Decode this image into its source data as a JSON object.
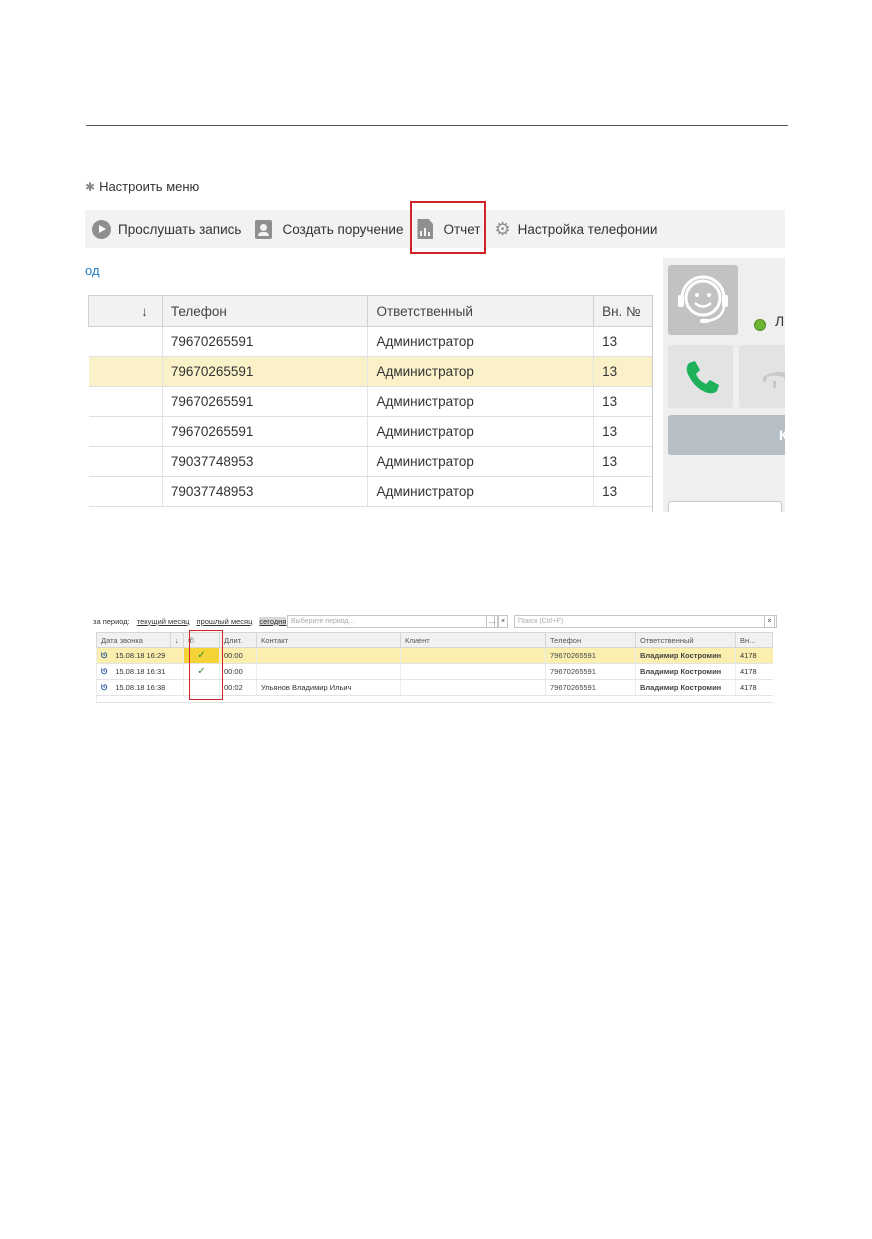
{
  "colors": {
    "accent_red": "#d2232a",
    "selected_row": "#faf1c8",
    "link_blue": "#1f7ac2",
    "status_green": "#6bb533",
    "call_green": "#1fb15a"
  },
  "screenshot1": {
    "menu_config": "Настроить меню",
    "toolbar": [
      {
        "label": "Прослушать запись",
        "icon": "play-icon"
      },
      {
        "label": "Создать поручение",
        "icon": "task-icon"
      },
      {
        "label": "Отчет",
        "icon": "report-icon"
      },
      {
        "label": "Настройка телефонии",
        "icon": "gear-icon"
      }
    ],
    "period_link": "од",
    "table": {
      "columns": [
        "↓",
        "Телефон",
        "Ответственный",
        "Вн. №"
      ],
      "rows": [
        {
          "phone": "79670265591",
          "responsible": "Администратор",
          "ext": "13"
        },
        {
          "phone": "79670265591",
          "responsible": "Администратор",
          "ext": "13",
          "selected": true
        },
        {
          "phone": "79670265591",
          "responsible": "Администратор",
          "ext": "13"
        },
        {
          "phone": "79670265591",
          "responsible": "Администратор",
          "ext": "13"
        },
        {
          "phone": "79037748953",
          "responsible": "Администратор",
          "ext": "13"
        },
        {
          "phone": "79037748953",
          "responsible": "Администратор",
          "ext": "13"
        }
      ]
    },
    "panel": {
      "status_letter": "Л",
      "wide_button_letter": "К"
    }
  },
  "screenshot2": {
    "filter": {
      "label": "за период:",
      "links": [
        "текущий месяц",
        "прошлый месяц",
        "сегодня"
      ],
      "period_placeholder": "Выберите период...",
      "period_dots": "...",
      "clear": "×",
      "search_placeholder": "Поиск (Ctrl+F)"
    },
    "columns": [
      "Дата звонка",
      "↓",
      "✆",
      "Длит.",
      "Контакт",
      "Клиент",
      "Телефон",
      "Ответственный",
      "Вн..."
    ],
    "rows": [
      {
        "date": "15.08.18 16:29",
        "check": "✓",
        "duration": "00:00",
        "contact": "",
        "client": "",
        "phone": "79670265591",
        "responsible": "Владимир Костромин",
        "ext": "4178",
        "selected": true
      },
      {
        "date": "15.08.18 16:31",
        "check": "✓",
        "duration": "00:00",
        "contact": "",
        "client": "",
        "phone": "79670265591",
        "responsible": "Владимир Костромин",
        "ext": "4178"
      },
      {
        "date": "15.08.18 16:38",
        "check": "",
        "duration": "00:02",
        "contact": "Ульянов Владимир Ильич",
        "client": "",
        "phone": "79670265591",
        "responsible": "Владимир Костромин",
        "ext": "4178"
      }
    ]
  }
}
